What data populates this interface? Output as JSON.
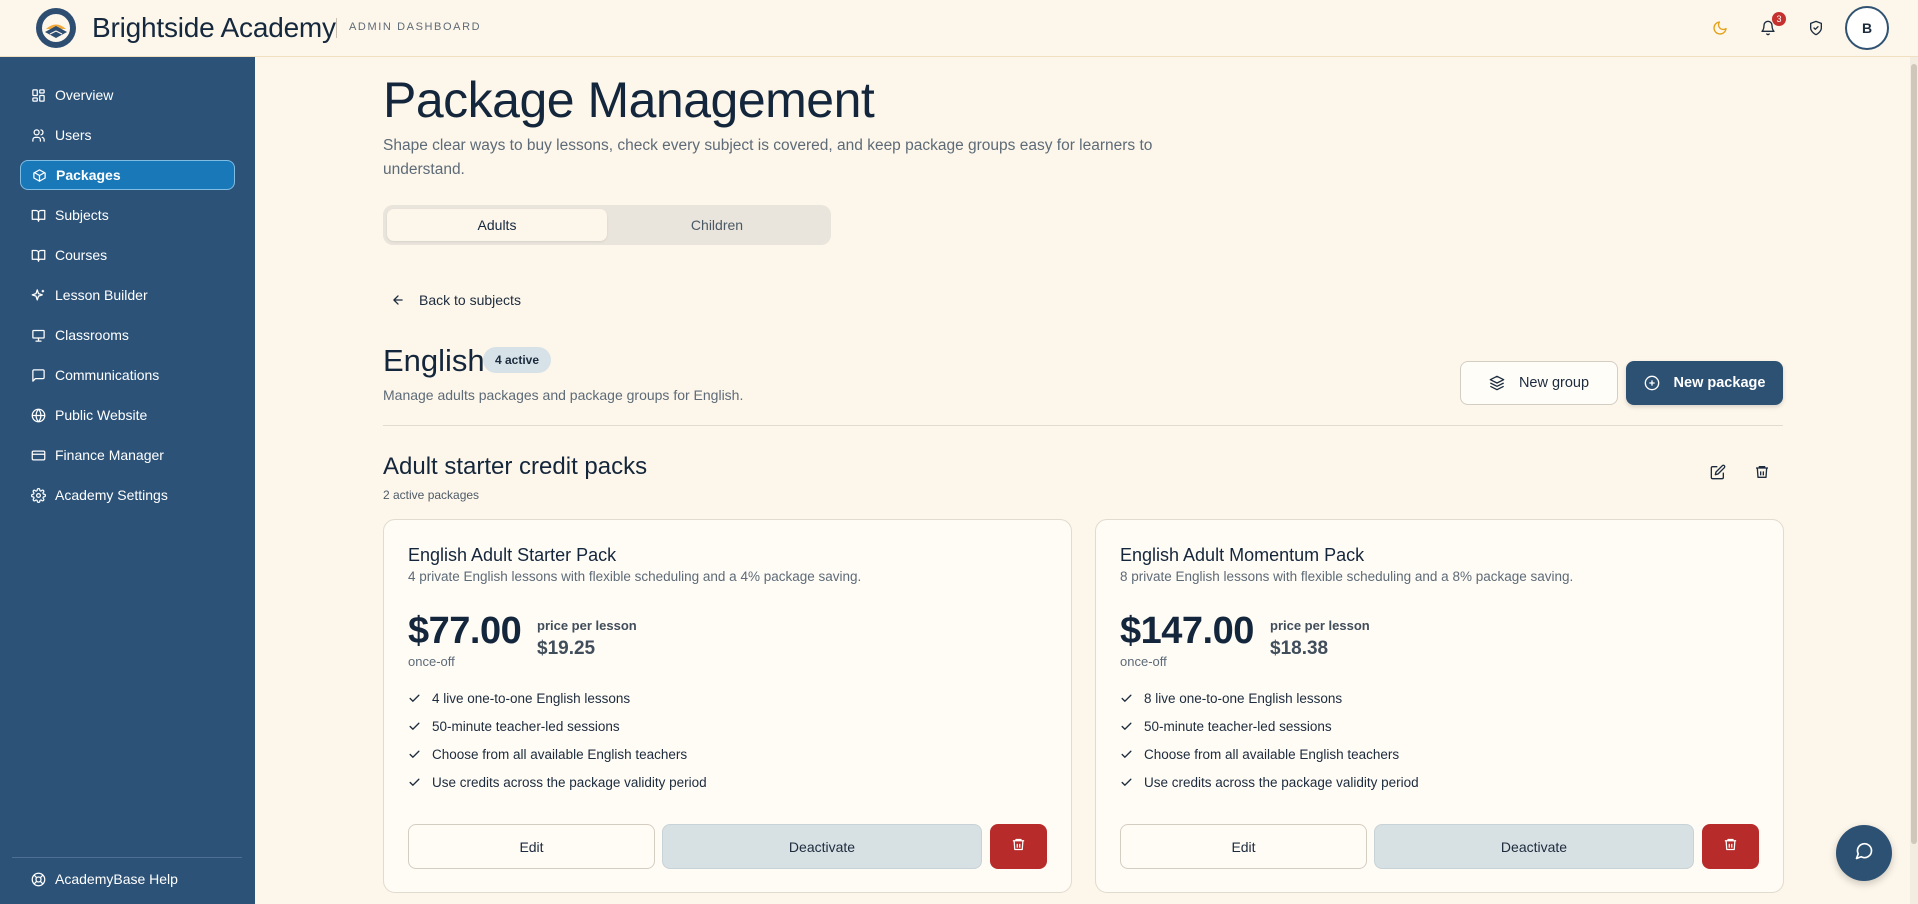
{
  "header": {
    "brand": "Brightside Academy",
    "subtitle": "ADMIN DASHBOARD",
    "notifications_count": "3",
    "avatar_initial": "B",
    "icons": [
      "moon-icon",
      "bell-icon",
      "shield-check-icon"
    ]
  },
  "sidebar": {
    "items": [
      {
        "label": "Overview",
        "icon": "grid-icon"
      },
      {
        "label": "Users",
        "icon": "users-icon"
      },
      {
        "label": "Packages",
        "icon": "package-icon",
        "active": true
      },
      {
        "label": "Subjects",
        "icon": "book-open-icon"
      },
      {
        "label": "Courses",
        "icon": "book-icon"
      },
      {
        "label": "Lesson Builder",
        "icon": "sparkles-icon"
      },
      {
        "label": "Classrooms",
        "icon": "presentation-icon"
      },
      {
        "label": "Communications",
        "icon": "message-icon"
      },
      {
        "label": "Public Website",
        "icon": "globe-icon"
      },
      {
        "label": "Finance Manager",
        "icon": "credit-card-icon"
      },
      {
        "label": "Academy Settings",
        "icon": "gear-icon"
      }
    ],
    "help": {
      "label": "AcademyBase Help",
      "icon": "help-circle-icon"
    }
  },
  "main": {
    "title": "Package Management",
    "description": "Shape clear ways to buy lessons, check every subject is covered, and keep package groups easy for learners to understand.",
    "tabs": [
      {
        "label": "Adults",
        "active": true
      },
      {
        "label": "Children",
        "active": false
      }
    ],
    "back_label": "Back to subjects",
    "subject": {
      "name": "English",
      "badge": "4 active",
      "description": "Manage adults packages and package groups for English."
    },
    "new_group_label": "New group",
    "new_package_label": "New package",
    "group": {
      "title": "Adult starter credit packs",
      "subtitle": "2 active packages"
    },
    "packages": [
      {
        "name": "English Adult Starter Pack",
        "description": "4 private English lessons with flexible scheduling and a 4% package saving.",
        "price": "$77.00",
        "frequency": "once-off",
        "per_lesson_label": "price per lesson",
        "per_lesson_value": "$19.25",
        "features": [
          "4 live one-to-one English lessons",
          "50-minute teacher-led sessions",
          "Choose from all available English teachers",
          "Use credits across the package validity period"
        ],
        "edit_label": "Edit",
        "deactivate_label": "Deactivate"
      },
      {
        "name": "English Adult Momentum Pack",
        "description": "8 private English lessons with flexible scheduling and a 8% package saving.",
        "price": "$147.00",
        "frequency": "once-off",
        "per_lesson_label": "price per lesson",
        "per_lesson_value": "$18.38",
        "features": [
          "8 live one-to-one English lessons",
          "50-minute teacher-led sessions",
          "Choose from all available English teachers",
          "Use credits across the package validity period"
        ],
        "edit_label": "Edit",
        "deactivate_label": "Deactivate"
      }
    ]
  },
  "colors": {
    "sidebar_bg": "#2c5278",
    "active_nav": "#1978b8",
    "primary_button": "#2d5173",
    "danger": "#b72c2a",
    "page_bg": "#fdf6ea"
  }
}
